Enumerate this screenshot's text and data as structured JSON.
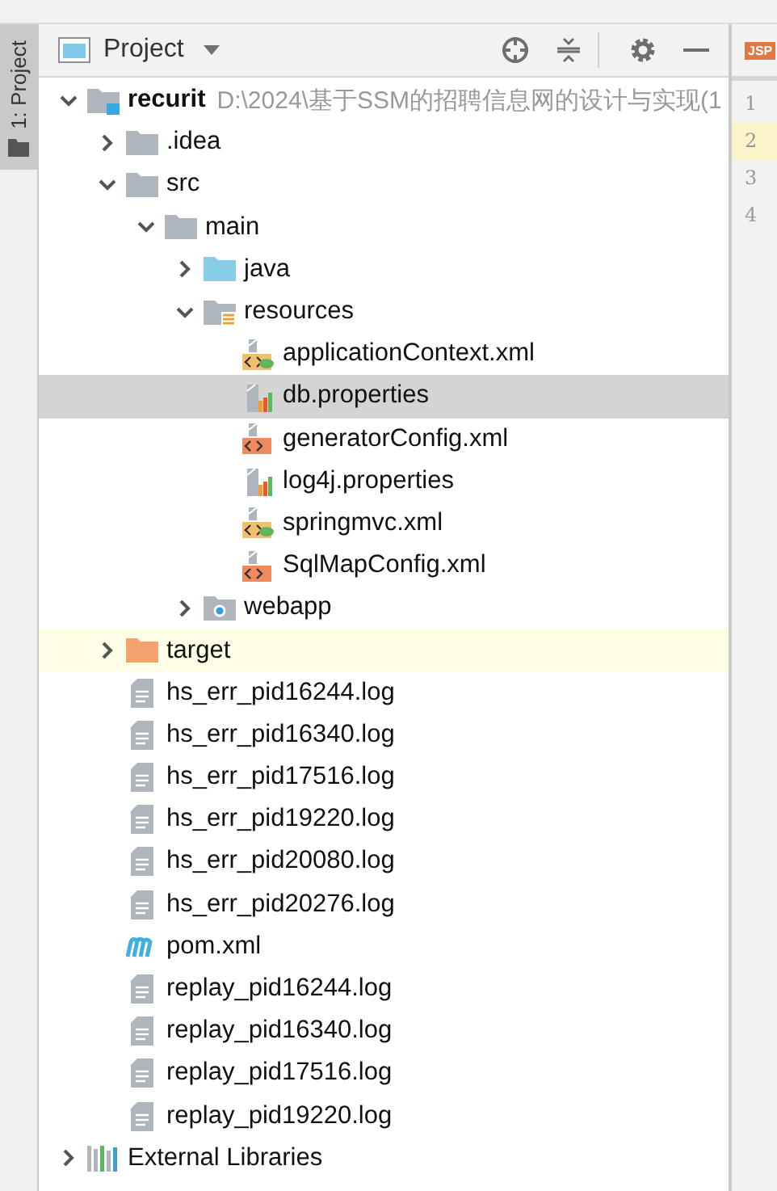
{
  "side_tab": {
    "label": "1: Project",
    "selected": true
  },
  "panel": {
    "title": "Project"
  },
  "tree": [
    {
      "name": "recurit",
      "path": "D:\\2024\\基于SSM的招聘信息网的设计与实现(1",
      "kind": "project",
      "expanded": true,
      "selected": false,
      "highlighted": false,
      "children": [
        {
          "name": ".idea",
          "kind": "folder",
          "expanded": false,
          "selected": false,
          "highlighted": false
        },
        {
          "name": "src",
          "kind": "folder",
          "expanded": true,
          "selected": false,
          "highlighted": false,
          "children": [
            {
              "name": "main",
              "kind": "folder",
              "expanded": true,
              "selected": false,
              "highlighted": false,
              "children": [
                {
                  "name": "java",
                  "kind": "source",
                  "expanded": false,
                  "selected": false,
                  "highlighted": false
                },
                {
                  "name": "resources",
                  "kind": "resources",
                  "expanded": true,
                  "selected": false,
                  "highlighted": false,
                  "children": [
                    {
                      "name": "applicationContext.xml",
                      "kind": "spring",
                      "selected": false,
                      "highlighted": false
                    },
                    {
                      "name": "db.properties",
                      "kind": "properties",
                      "selected": true,
                      "highlighted": false
                    },
                    {
                      "name": "generatorConfig.xml",
                      "kind": "xml",
                      "selected": false,
                      "highlighted": false
                    },
                    {
                      "name": "log4j.properties",
                      "kind": "properties",
                      "selected": false,
                      "highlighted": false
                    },
                    {
                      "name": "springmvc.xml",
                      "kind": "spring",
                      "selected": false,
                      "highlighted": false
                    },
                    {
                      "name": "SqlMapConfig.xml",
                      "kind": "xml",
                      "selected": false,
                      "highlighted": false
                    }
                  ]
                },
                {
                  "name": "webapp",
                  "kind": "web",
                  "expanded": false,
                  "selected": false,
                  "highlighted": false
                }
              ]
            }
          ]
        },
        {
          "name": "target",
          "kind": "excluded",
          "expanded": false,
          "selected": false,
          "highlighted": true
        },
        {
          "name": "hs_err_pid16244.log",
          "kind": "log",
          "selected": false,
          "highlighted": false
        },
        {
          "name": "hs_err_pid16340.log",
          "kind": "log",
          "selected": false,
          "highlighted": false
        },
        {
          "name": "hs_err_pid17516.log",
          "kind": "log",
          "selected": false,
          "highlighted": false
        },
        {
          "name": "hs_err_pid19220.log",
          "kind": "log",
          "selected": false,
          "highlighted": false
        },
        {
          "name": "hs_err_pid20080.log",
          "kind": "log",
          "selected": false,
          "highlighted": false
        },
        {
          "name": "hs_err_pid20276.log",
          "kind": "log",
          "selected": false,
          "highlighted": false
        },
        {
          "name": "pom.xml",
          "kind": "maven",
          "selected": false,
          "highlighted": false
        },
        {
          "name": "replay_pid16244.log",
          "kind": "log",
          "selected": false,
          "highlighted": false
        },
        {
          "name": "replay_pid16340.log",
          "kind": "log",
          "selected": false,
          "highlighted": false
        },
        {
          "name": "replay_pid17516.log",
          "kind": "log",
          "selected": false,
          "highlighted": false
        },
        {
          "name": "replay_pid19220.log",
          "kind": "log",
          "selected": false,
          "highlighted": false
        }
      ]
    },
    {
      "name": "External Libraries",
      "kind": "libraries",
      "expanded": false,
      "selected": false,
      "highlighted": false
    }
  ],
  "editor": {
    "tab_icon": "JSP",
    "lines": [
      {
        "number": "1",
        "current": false
      },
      {
        "number": "2",
        "current": true
      },
      {
        "number": "3",
        "current": false
      },
      {
        "number": "4",
        "current": false
      }
    ]
  }
}
